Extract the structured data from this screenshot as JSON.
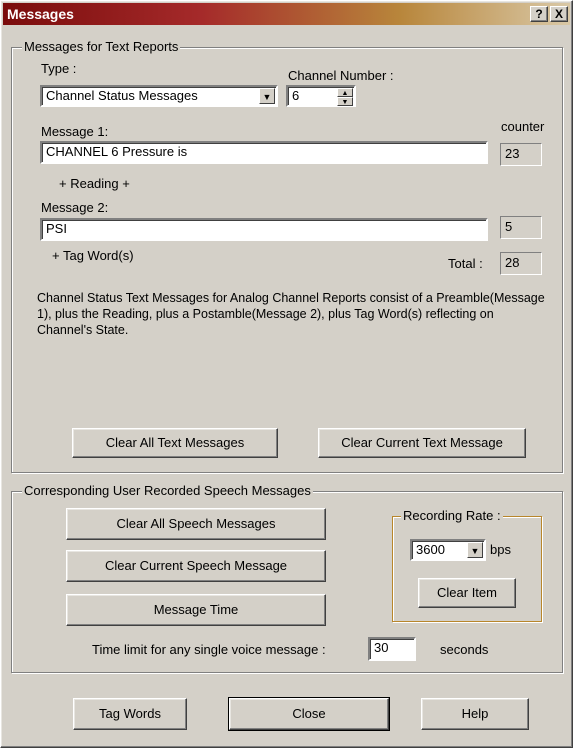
{
  "window": {
    "title": "Messages",
    "help_btn": "?",
    "close_btn": "X"
  },
  "text_reports": {
    "group_title": "Messages for Text Reports",
    "type_label": "Type :",
    "type_value": "Channel Status Messages",
    "channel_label": "Channel Number :",
    "channel_value": "6",
    "counter_label": "counter",
    "message1_label": "Message 1:",
    "message1_value": "CHANNEL 6 Pressure is",
    "message1_count": "23",
    "reading_label": "+ Reading +",
    "message2_label": "Message 2:",
    "message2_value": "PSI",
    "message2_count": "5",
    "tagword_label": "+ Tag Word(s)",
    "total_label": "Total :",
    "total_value": "28",
    "description": "Channel Status Text Messages for Analog Channel Reports consist of a Preamble(Message 1), plus the Reading, plus a Postamble(Message 2), plus Tag Word(s) reflecting on Channel's State.",
    "clear_all_btn": "Clear All Text Messages",
    "clear_current_btn": "Clear Current Text Message"
  },
  "speech": {
    "group_title": "Corresponding User Recorded Speech Messages",
    "clear_all_btn": "Clear All Speech Messages",
    "clear_current_btn": "Clear Current Speech Message",
    "message_time_btn": "Message Time",
    "rate_group_title": "Recording Rate :",
    "rate_value": "3600",
    "rate_unit": "bps",
    "clear_item_btn": "Clear Item",
    "time_limit_label": "Time limit for any single voice message :",
    "time_limit_value": "30",
    "time_limit_unit": "seconds"
  },
  "footer": {
    "tag_words_btn": "Tag Words",
    "close_btn": "Close",
    "help_btn": "Help"
  }
}
